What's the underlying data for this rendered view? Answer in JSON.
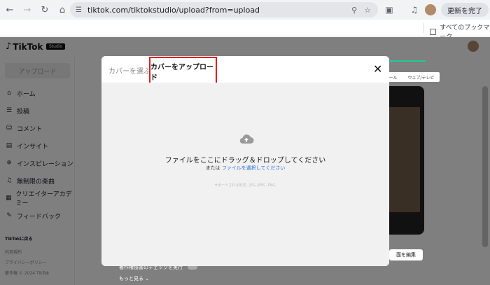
{
  "browser": {
    "url": "tiktok.com/tiktokstudio/upload?from=upload",
    "update_label": "更新を完了",
    "bookmark_label": "すべてのブックマーク"
  },
  "header": {
    "logo": "TikTok",
    "badge": "Studio"
  },
  "sidebar": {
    "upload_label": "アップロード",
    "items": [
      {
        "icon": "home-icon",
        "label": "ホーム"
      },
      {
        "icon": "list-icon",
        "label": "投稿"
      },
      {
        "icon": "comment-icon",
        "label": "コメント"
      },
      {
        "icon": "chart-icon",
        "label": "インサイト"
      },
      {
        "icon": "bulb-icon",
        "label": "インスピレーション"
      },
      {
        "icon": "music-icon",
        "label": "無制限の楽曲"
      },
      {
        "icon": "academy-icon",
        "label": "クリエイターアカデミー"
      },
      {
        "icon": "feedback-icon",
        "label": "フィードバック"
      }
    ],
    "footer_heading": "TikTokに戻る",
    "footer_lines": [
      "利用規約",
      "プライバシーポリシー",
      "著作権 © 2024 TikTok"
    ]
  },
  "background": {
    "right_tabs": [
      "ール",
      "ウェブ/テレビ"
    ],
    "edit_label": "面を編集",
    "bottom_row": "著作権侵害のチェックを実行",
    "more_label": "もっと見る"
  },
  "modal": {
    "tab_select": "カバーを選ぶ",
    "tab_upload": "カバーをアップロード",
    "drop_main": "ファイルをここにドラッグ＆ドロップしてください",
    "drop_or": "または",
    "drop_link": "ファイルを選択してください",
    "formats": "サポートされる形式：JPG, JPEG, PNG."
  }
}
